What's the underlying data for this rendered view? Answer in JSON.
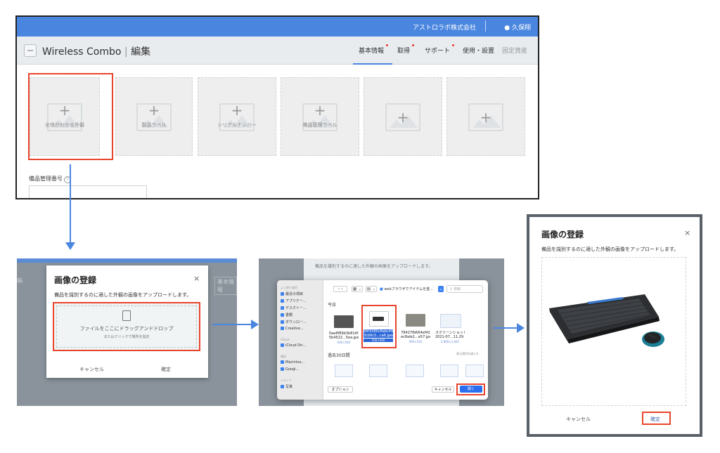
{
  "app": {
    "company": "アストロラボ株式会社",
    "user": "久保翔",
    "title": "Wireless Combo",
    "title_suffix": "編集",
    "tabs": [
      {
        "label": "基本情報",
        "active": true,
        "alert": true
      },
      {
        "label": "取得",
        "active": false,
        "alert": true
      },
      {
        "label": "サポート",
        "active": false,
        "alert": true
      },
      {
        "label": "使用・設置",
        "active": false,
        "alert": false
      },
      {
        "label": "固定資産",
        "active": false,
        "alert": false
      }
    ],
    "image_slots": [
      {
        "label": "全体がわかる外観"
      },
      {
        "label": "製品ラベル"
      },
      {
        "label": "シリアルナンバー"
      },
      {
        "label": "備品管理ラベル"
      },
      {
        "label": ""
      },
      {
        "label": ""
      }
    ],
    "mgmt_number_label": "備品管理番号",
    "help_icon": "?"
  },
  "upload_modal": {
    "title": "画像の登録",
    "description": "備品を識別するのに適した外観の画像をアップロードします。",
    "drop_text": "ファイルをここにドラッグアンドドロップ",
    "drop_subtext": "またはクリックで場所を指定",
    "cancel": "キャンセル",
    "confirm": "確定",
    "close": "×",
    "bg_tab": "基本情報",
    "bg_left": "編"
  },
  "file_dialog": {
    "bg_text": "備品を識別するのに適した外観の画像をアップロードします。",
    "sidebar": {
      "favorites_header": "よく使う項目",
      "favorites": [
        "最近の項目",
        "アプリケー...",
        "デスクトー...",
        "書類",
        "ダウンロー...",
        "Creative..."
      ],
      "icloud_header": "iCloud",
      "icloud": [
        "iCloud Dri..."
      ],
      "locations_header": "場所",
      "locations": [
        "Macintos...",
        "Googl..."
      ],
      "media_header": "メディア",
      "media": [
        "写真"
      ]
    },
    "nav": "‹ ›",
    "view1": "▦ ⌄",
    "view2": "▤ ⌄",
    "folder": "webブラウザでアイテムを登...",
    "folder_icon": "⌄",
    "search_placeholder": "検索",
    "today": "今日",
    "files": [
      {
        "name": "0ae8f89b3b814f2\n5b4522...5ea.jpeg",
        "size": "640×583"
      },
      {
        "name": "88f3380c8abc49\n3cb6c5...ca6.jpeg",
        "size": "500×500"
      },
      {
        "name": "78427fb664ef42\nec8afe1...e57.jpeg",
        "size": "960×544"
      },
      {
        "name": "スクリーンショット\n2021-07...11.29.52",
        "size": "2,860×1,842"
      }
    ],
    "past30": "過去30日間",
    "show_more": "表示項目を減らす",
    "options": "オプション",
    "cancel": "キャンセル",
    "open": "開く"
  },
  "result_modal": {
    "title": "画像の登録",
    "description": "備品を識別するのに適した外観の画像をアップロードします。",
    "cancel": "キャンセル",
    "confirm": "確定",
    "close": "×"
  },
  "colors": {
    "header_blue": "#4a86e0",
    "highlight": "#e8452c",
    "arrow": "#4a86e0",
    "open_button": "#2a6ef0"
  }
}
